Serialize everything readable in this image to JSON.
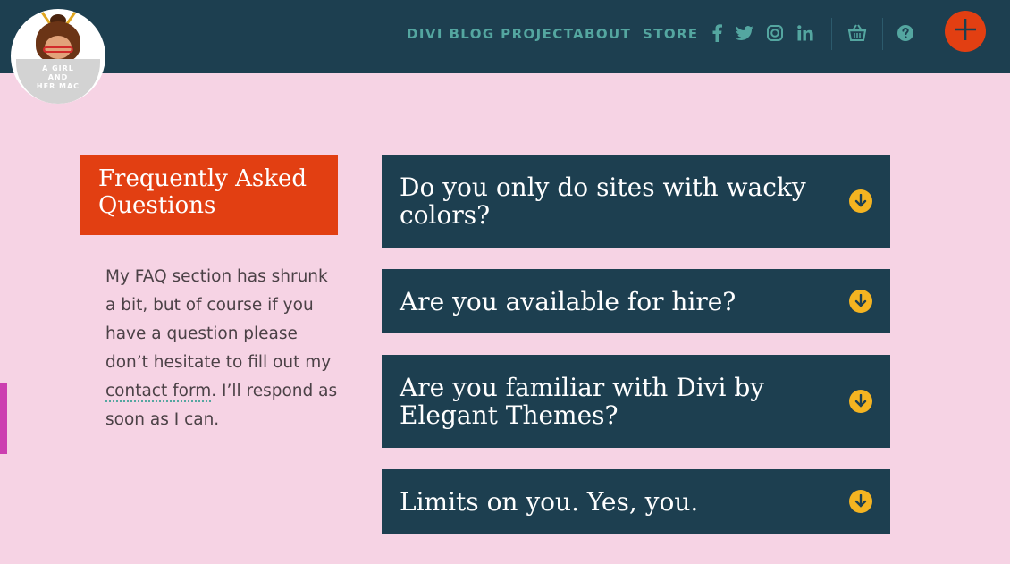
{
  "logo": {
    "text_lines": [
      "A GIRL",
      "AND",
      "HER MAC"
    ]
  },
  "nav": {
    "items": [
      {
        "label": "DIVI BLOG PROJECT"
      },
      {
        "label": "ABOUT"
      },
      {
        "label": "STORE"
      }
    ],
    "social_icons": [
      "facebook-icon",
      "twitter-icon",
      "instagram-icon",
      "linkedin-icon"
    ],
    "utility_icons": [
      "basket-icon",
      "help-icon",
      "plus-icon"
    ]
  },
  "faq": {
    "title": "Frequently Asked Questions",
    "intro_before_link": "My FAQ section has shrunk a bit, but of course if you have a question please don’t hesitate to fill out my ",
    "link_text": "contact form",
    "intro_after_link": ". I’ll respond as soon as I can."
  },
  "accordion": [
    {
      "question": "Do you only do sites with wacky colors?"
    },
    {
      "question": "Are you available for hire?"
    },
    {
      "question": "Are you familiar with Divi by Elegant Themes?"
    },
    {
      "question": "Limits on you. Yes, you."
    }
  ],
  "colors": {
    "background": "#f6d3e4",
    "header": "#1d3f50",
    "accent_red": "#e23f12",
    "nav_teal": "#54a6a0",
    "toggle_yellow": "#f4b421",
    "side_bar_magenta": "#cc3fb0"
  }
}
